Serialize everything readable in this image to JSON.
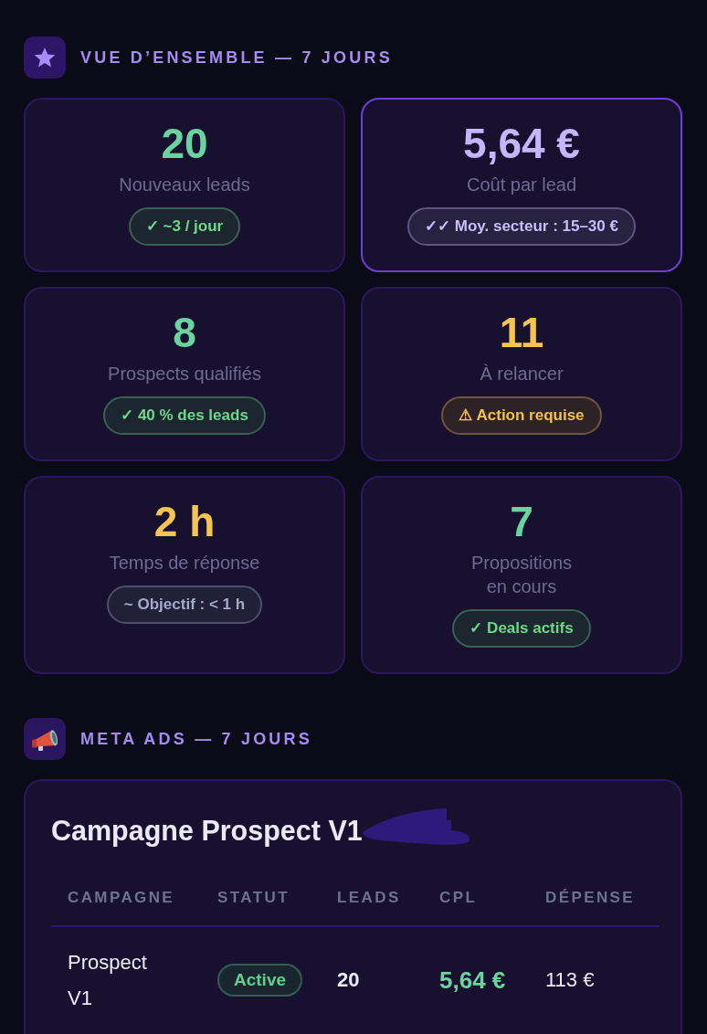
{
  "overview": {
    "heading": "VUE D’ENSEMBLE — 7 JOURS",
    "stats": [
      {
        "value": {
          "text": "20",
          "color": "#6bd3a0"
        },
        "label": "Nouveaux leads",
        "badge": {
          "text": "✓ ~3 / jour",
          "color": "#6fd88a"
        },
        "highlighted": false
      },
      {
        "value": {
          "text": "5,64 €",
          "color": "#c4b5fd"
        },
        "label": "Coût par lead",
        "badge": {
          "text": "✓✓ Moy. secteur : 15–30 €",
          "color": "#c9bdfc"
        },
        "highlighted": true
      },
      {
        "value": {
          "text": "8",
          "color": "#6bd3a0"
        },
        "label": "Prospects qualifiés",
        "badge": {
          "text": "✓ 40 % des leads",
          "color": "#6fd88a"
        },
        "highlighted": false
      },
      {
        "value": {
          "text": "11",
          "color": "#f6c451"
        },
        "label": "À relancer",
        "badge": {
          "text": "⚠ Action requise",
          "color": "#f5c04a"
        },
        "highlighted": false
      },
      {
        "value": {
          "text": "2 h",
          "color": "#f6c451"
        },
        "label": "Temps de réponse",
        "badge": {
          "text": "~ Objectif : < 1 h",
          "color": "#a3abc8"
        },
        "highlighted": false
      },
      {
        "value": {
          "text": "7",
          "color": "#6bd3a0"
        },
        "label": "Propositions en cours",
        "badge": {
          "text": "✓ Deals actifs",
          "color": "#6fd88a"
        },
        "highlighted": false
      }
    ]
  },
  "meta_ads": {
    "heading": "META ADS — 7 JOURS",
    "campaign": {
      "title": "Campagne Prospect V1",
      "table": {
        "columns": [
          "CAMPAGNE",
          "STATUT",
          "LEADS",
          "CPL",
          "DÉPENSE"
        ],
        "rows": [
          {
            "campaign": "Prospect V1",
            "status": {
              "text": "Active",
              "color": "#62cf8a"
            },
            "leads": "20",
            "cpl": "5,64 €",
            "spend": "113 €"
          }
        ]
      }
    }
  }
}
